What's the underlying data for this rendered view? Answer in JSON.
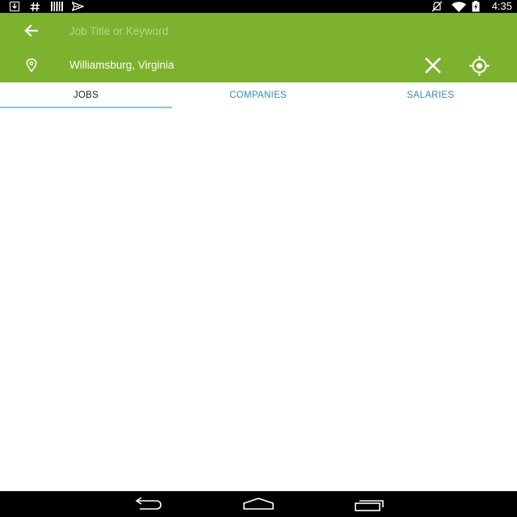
{
  "status_bar": {
    "time": "4:35",
    "left_icons": [
      "download-icon",
      "hashtag-icon",
      "barcode-icon",
      "send-icon"
    ],
    "right_icons": [
      "mute-icon",
      "wifi-icon",
      "battery-charging-icon"
    ]
  },
  "search": {
    "keyword_placeholder": "Job Title or Keyword",
    "keyword_value": "",
    "location_value": "Williamsburg, Virginia"
  },
  "tabs": [
    {
      "label": "JOBS",
      "active": true
    },
    {
      "label": "COMPANIES",
      "active": false
    },
    {
      "label": "SALARIES",
      "active": false
    }
  ],
  "nav_bar": {
    "buttons": [
      "back-icon",
      "home-icon",
      "recent-apps-icon"
    ]
  },
  "colors": {
    "header_green": "#7cb22d",
    "tab_active_text": "#222222",
    "tab_inactive_text": "#2e8fc8",
    "tab_indicator": "#7fcbe8",
    "bar_black": "#000000"
  }
}
